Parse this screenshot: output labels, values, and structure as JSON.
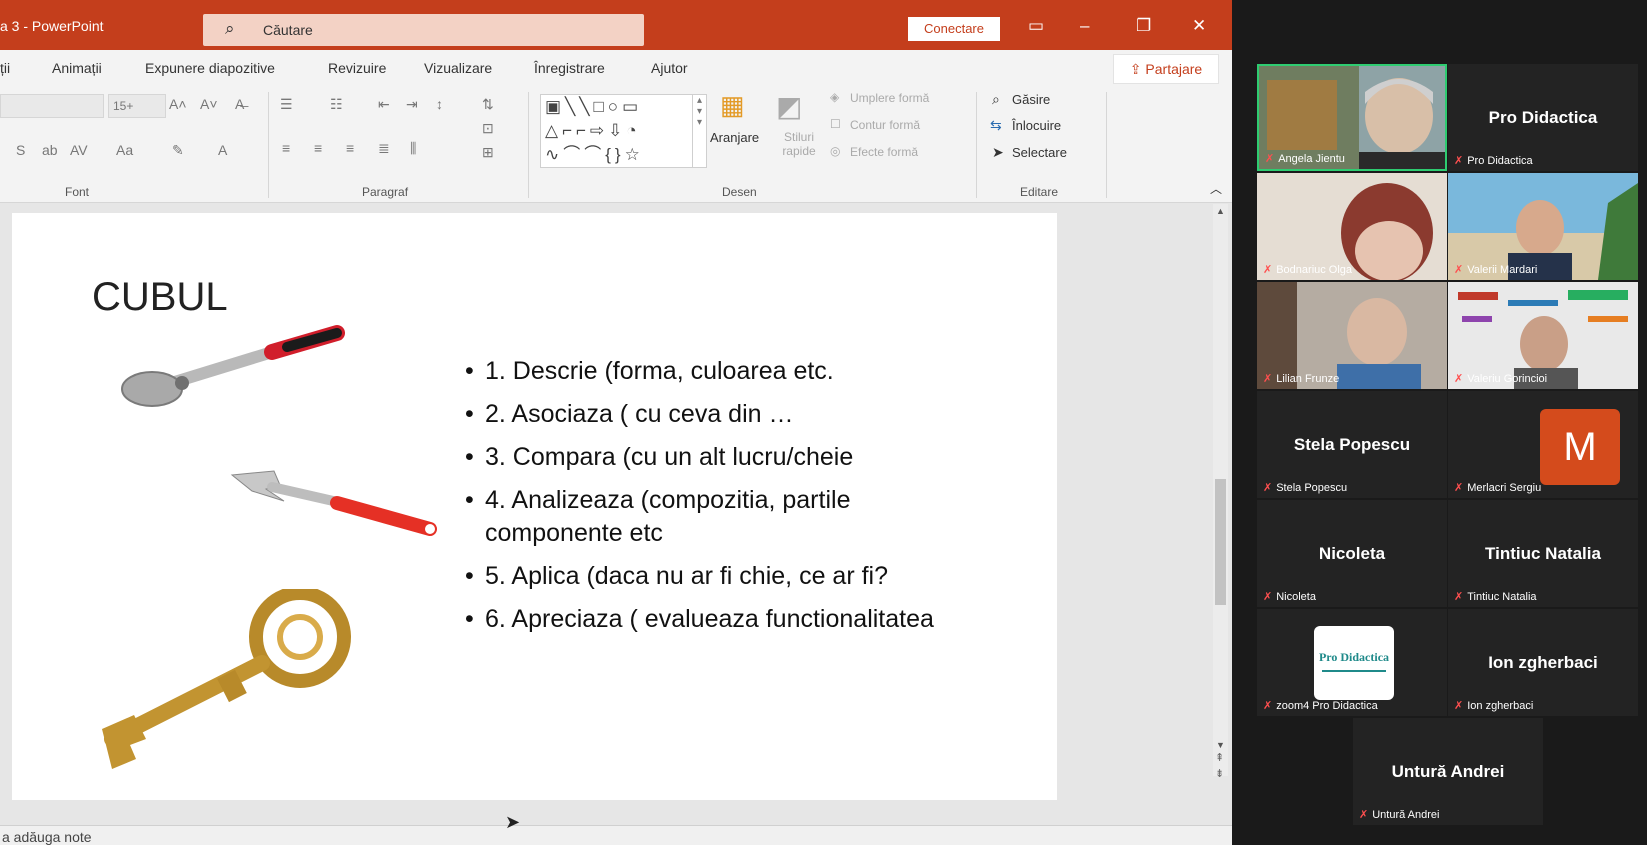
{
  "titlebar": {
    "doc_name": "a 3 - PowerPoint",
    "search_placeholder": "Căutare",
    "connect_label": "Conectare"
  },
  "tabs": [
    "ții",
    "Animații",
    "Expunere diapozitive",
    "Revizuire",
    "Vizualizare",
    "Înregistrare",
    "Ajutor"
  ],
  "share_label": "Partajare",
  "ribbon": {
    "groups": [
      "Font",
      "Paragraf",
      "Desen",
      "Editare"
    ],
    "font_size": "15+",
    "arrange_label": "Aranjare",
    "quick_styles_label": "Stiluri rapide",
    "fill_label": "Umplere formă",
    "outline_label": "Contur formă",
    "effects_label": "Efecte formă",
    "find_label": "Găsire",
    "replace_label": "Înlocuire",
    "select_label": "Selectare"
  },
  "slide": {
    "title": "CUBUL",
    "bullets": [
      "1. Descrie (forma, culoarea etc.",
      "2. Asociaza ( cu ceva din …",
      "3. Compara (cu un alt lucru/cheie",
      "4. Analizeaza (compozitia, partile componente etc",
      "5. Aplica (daca nu ar fi chie, ce ar fi?",
      "6. Apreciaza ( evalueaza functionalitatea"
    ]
  },
  "notes_label": "a adăuga note",
  "participants": [
    {
      "name": "Angela Jientu",
      "display": "",
      "video": true,
      "photo_bg": "#7a8c6a"
    },
    {
      "name": "Pro Didactica",
      "display": "Pro Didactica",
      "video": false
    },
    {
      "name": "Bodnariuc Olga",
      "display": "",
      "video": true,
      "photo_bg": "#c9b8a6"
    },
    {
      "name": "Valerii Mardari",
      "display": "",
      "video": true,
      "photo_bg": "#5da0c4"
    },
    {
      "name": "Lilian Frunze",
      "display": "",
      "video": true,
      "photo_bg": "#8a7f75"
    },
    {
      "name": "Valeriu Gorincioi",
      "display": "",
      "video": true,
      "photo_bg": "#d9d9d9"
    },
    {
      "name": "Stela Popescu",
      "display": "Stela Popescu",
      "video": false
    },
    {
      "name": "Merlacri Sergiu",
      "display": "",
      "video": false,
      "avatar_letter": "M"
    },
    {
      "name": "Nicoleta",
      "display": "Nicoleta",
      "video": false
    },
    {
      "name": "Tintiuc Natalia",
      "display": "Tintiuc Natalia",
      "video": false
    },
    {
      "name": "zoom4 Pro Didactica",
      "display": "",
      "video": false,
      "logo": "Pro Didactica"
    },
    {
      "name": "Ion zgherbaci",
      "display": "Ion zgherbaci",
      "video": false
    },
    {
      "name": "Untură Andrei",
      "display": "Untură Andrei",
      "video": false
    }
  ],
  "colors": {
    "ppt_accent": "#c43e1c",
    "zoom_bg": "#1a1a1a",
    "active_speaker": "#2ecc71",
    "avatar_orange": "#d44b1c"
  }
}
